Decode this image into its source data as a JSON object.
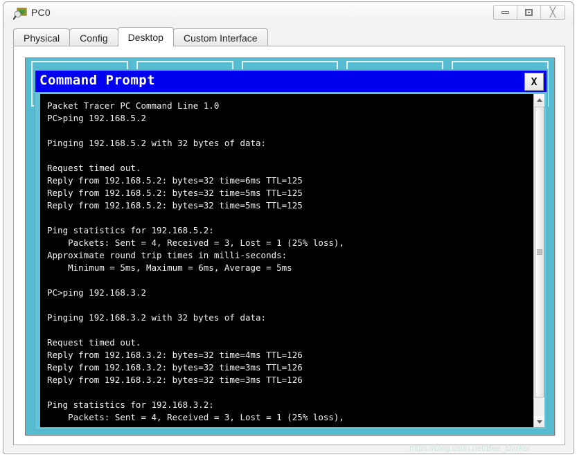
{
  "window": {
    "title": "PC0",
    "icon": "device-magnifier-icon",
    "controls": {
      "minimize_label": "",
      "maximize_label": "",
      "close_label": "╳"
    }
  },
  "tabs": [
    {
      "label": "Physical",
      "active": false
    },
    {
      "label": "Config",
      "active": false
    },
    {
      "label": "Desktop",
      "active": true
    },
    {
      "label": "Custom Interface",
      "active": false
    }
  ],
  "desktop": {
    "background_color": "#56bcd2",
    "tiles": [
      {
        "name": "desktop-app-tile-1"
      },
      {
        "name": "desktop-app-tile-2"
      },
      {
        "name": "desktop-app-tile-3"
      },
      {
        "name": "desktop-app-tile-4"
      },
      {
        "name": "desktop-app-tile-5"
      }
    ]
  },
  "command_prompt": {
    "title": "Command Prompt",
    "title_bar_color": "#0000f0",
    "close_label": "X",
    "terminal_background": "#000000",
    "terminal_foreground": "#f2f2f2",
    "lines": [
      "Packet Tracer PC Command Line 1.0",
      "PC>ping 192.168.5.2",
      "",
      "Pinging 192.168.5.2 with 32 bytes of data:",
      "",
      "Request timed out.",
      "Reply from 192.168.5.2: bytes=32 time=6ms TTL=125",
      "Reply from 192.168.5.2: bytes=32 time=5ms TTL=125",
      "Reply from 192.168.5.2: bytes=32 time=5ms TTL=125",
      "",
      "Ping statistics for 192.168.5.2:",
      "    Packets: Sent = 4, Received = 3, Lost = 1 (25% loss),",
      "Approximate round trip times in milli-seconds:",
      "    Minimum = 5ms, Maximum = 6ms, Average = 5ms",
      "",
      "PC>ping 192.168.3.2",
      "",
      "Pinging 192.168.3.2 with 32 bytes of data:",
      "",
      "Request timed out.",
      "Reply from 192.168.3.2: bytes=32 time=4ms TTL=126",
      "Reply from 192.168.3.2: bytes=32 time=3ms TTL=126",
      "Reply from 192.168.3.2: bytes=32 time=3ms TTL=126",
      "",
      "Ping statistics for 192.168.3.2:",
      "    Packets: Sent = 4, Received = 3, Lost = 1 (25% loss),"
    ],
    "scrollbar": {
      "up_arrow": "scroll-up-arrow",
      "down_arrow": "scroll-down-arrow"
    }
  },
  "watermark": "https://blog.csdn.net/Bee_Darker"
}
